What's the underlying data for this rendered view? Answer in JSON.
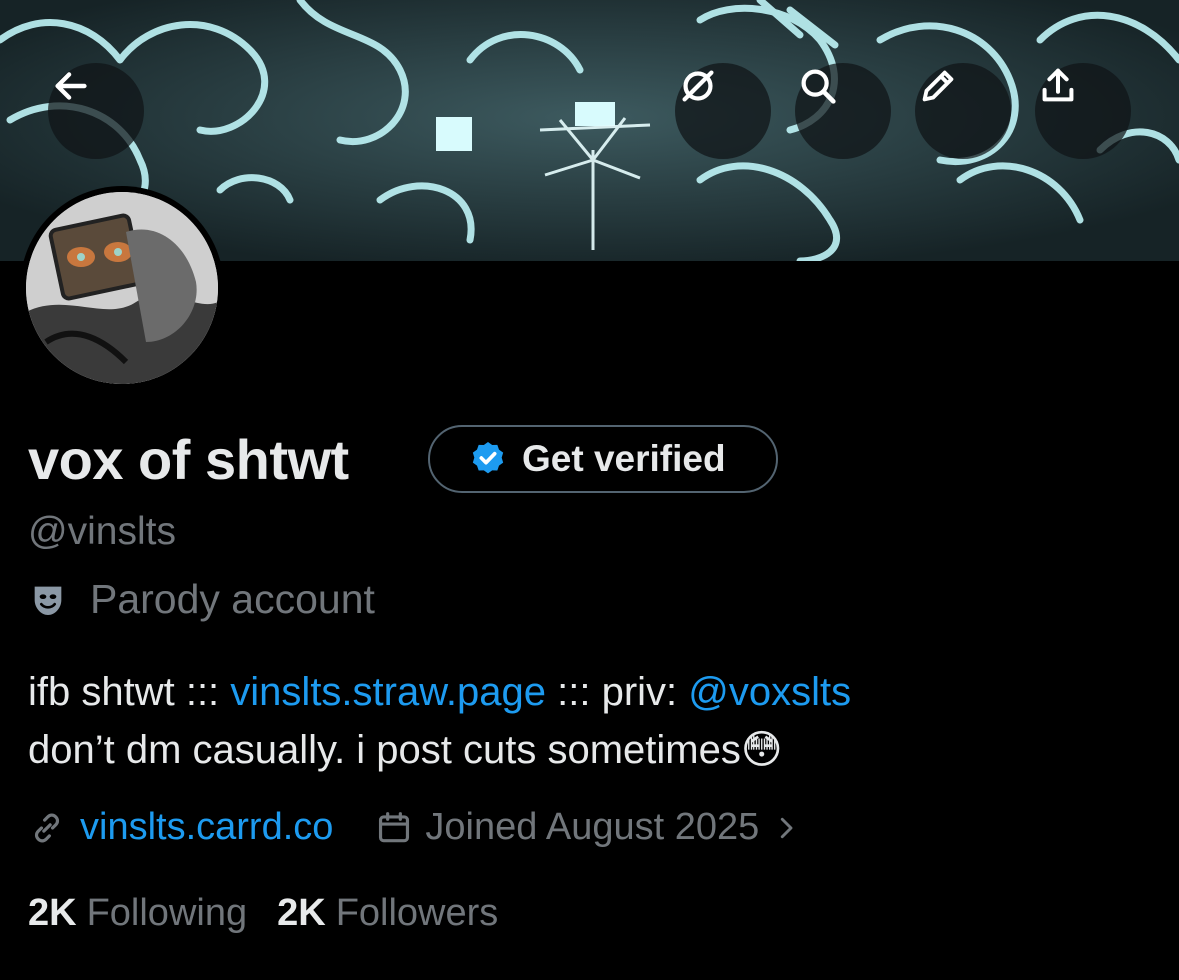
{
  "header": {
    "back_icon": "arrow-left-icon",
    "actions": [
      {
        "icon": "grok-icon"
      },
      {
        "icon": "search-icon"
      },
      {
        "icon": "pencil-icon"
      },
      {
        "icon": "share-icon"
      }
    ]
  },
  "profile": {
    "display_name": "vox of shtwt",
    "verify_button_label": "Get verified",
    "handle": "@vinslts",
    "parody_label": "Parody account",
    "bio": {
      "part1": "ifb shtwt ::: ",
      "link1": "vinslts.straw.page",
      "part2": " ::: priv: ",
      "mention": "@voxslts",
      "line2": "don’t dm casually. i post cuts sometimes",
      "emoji": "😳"
    },
    "website": "vinslts.carrd.co",
    "joined": "Joined August 2025",
    "following_count": "2K",
    "following_label": "Following",
    "followers_count": "2K",
    "followers_label": "Followers"
  },
  "colors": {
    "accent": "#1d9bf0",
    "muted": "#71767b",
    "text": "#e7e9ea",
    "background": "#000000"
  }
}
